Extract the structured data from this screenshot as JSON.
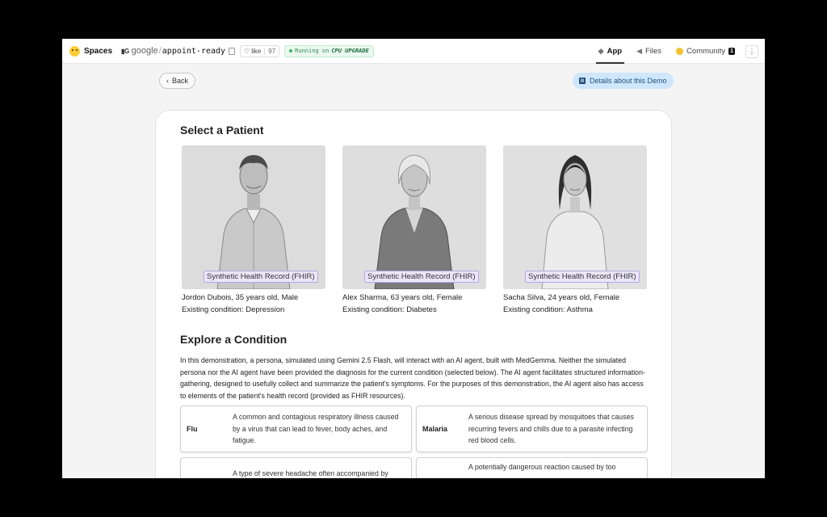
{
  "header": {
    "brand": "Spaces",
    "org_badge": "G",
    "org": "google",
    "repo": "appoint-ready",
    "like_label": "like",
    "like_count": "97",
    "status_prefix": "Running on",
    "hardware": "CPU UPGRADE",
    "tabs": [
      {
        "label": "App",
        "icon": "app-icon",
        "active": true
      },
      {
        "label": "Files",
        "icon": "files-icon",
        "active": false
      },
      {
        "label": "Community",
        "icon": "community-icon",
        "active": false,
        "count": "1"
      }
    ]
  },
  "nav": {
    "back_label": "Back",
    "details_label": "Details about this Demo"
  },
  "patients_section": {
    "title": "Select a Patient",
    "tag": "Synthetic Health Record (FHIR)",
    "patients": [
      {
        "name_line": "Jordon Dubois, 35 years old, Male",
        "condition_line": "Existing condition: Depression"
      },
      {
        "name_line": "Alex Sharma, 63 years old, Female",
        "condition_line": "Existing condition: Diabetes"
      },
      {
        "name_line": "Sacha Silva, 24 years old, Female",
        "condition_line": "Existing condition: Asthma"
      }
    ]
  },
  "conditions_section": {
    "title": "Explore a Condition",
    "intro": "In this demonstration, a persona, simulated using Gemini 2.5 Flash, will interact with an AI agent, built with MedGemma. Neither the simulated persona nor the AI agent have been provided the diagnosis for the current condition (selected below). The AI agent facilitates structured information-gathering, designed to usefully collect and summarize the patient's symptoms. For the purposes of this demonstration, the AI agent also has access to elements of the patient's health record (provided as FHIR resources).",
    "conditions": [
      {
        "name": "Flu",
        "description": "A common and contagious respiratory illness caused by a virus that can lead to fever, body aches, and fatigue."
      },
      {
        "name": "Malaria",
        "description": "A serious disease spread by mosquitoes that causes recurring fevers and chills due to a parasite infecting red blood cells."
      },
      {
        "name": "",
        "description": "A type of severe headache often accompanied by"
      },
      {
        "name": "",
        "description": "A potentially dangerous reaction caused by too"
      }
    ]
  },
  "colors": {
    "tag_bg": "#ebe5f8",
    "tag_border": "#b9a6e3",
    "details_bg": "#cfe6fb",
    "running_green": "#2f8a52"
  }
}
